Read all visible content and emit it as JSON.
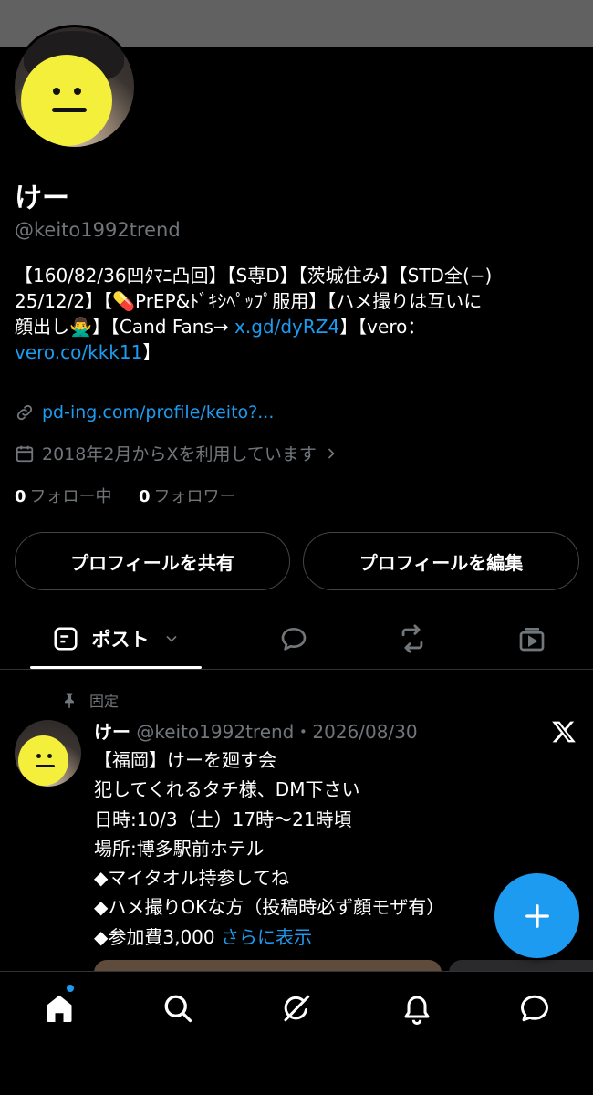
{
  "profile": {
    "name": "けー",
    "handle": "@keito1992trend",
    "bio_line1": "【160/82/36凹ﾀﾏﾆ凸回】【S専D】【茨城住み】【STD全(−)",
    "bio_line2": "25/12/2】【💊PrEP&ﾄﾞｷｼﾍﾟｯﾌﾟ服用】【ハメ撮りは互いに",
    "bio_line3a": "顔出し🙅‍♂️】【Cand Fans→ ",
    "bio_link1": "x.gd/dyRZ4",
    "bio_line3b": "】【vero：",
    "bio_link2": "vero.co/kkk11",
    "bio_line4b": "】",
    "website": "pd-ing.com/profile/keito?...",
    "joined": "2018年2月からXを利用しています",
    "following_count": "0",
    "following_label": "フォロー中",
    "followers_count": "0",
    "followers_label": "フォロワー"
  },
  "buttons": {
    "share": "プロフィールを共有",
    "edit": "プロフィールを編集"
  },
  "tabs": {
    "posts": "ポスト",
    "icons": [
      "reply-icon",
      "repost-icon",
      "media-icon"
    ]
  },
  "post": {
    "pinned_label": "固定",
    "author": "けー",
    "handle_date": " @keito1992trend・2026/08/30",
    "body": "【福岡】けーを廻す会\n犯してくれるタチ様、DM下さい\n日時:10/3（土）17時〜21時頃\n場所:博多駅前ホテル\n◆マイタオル持参してね\n◆ハメ撮りOKな方（投稿時必ず顔モザ有）\n◆参加費3,000 ",
    "more": "さらに表示"
  },
  "nav": {
    "items": [
      "home-icon",
      "search-icon",
      "grok-icon",
      "notifications-icon",
      "messages-icon"
    ]
  },
  "colors": {
    "background": "#000000",
    "accent": "#1d9bf0",
    "muted": "#71767b",
    "avatar_face": "#f4ef3a"
  }
}
